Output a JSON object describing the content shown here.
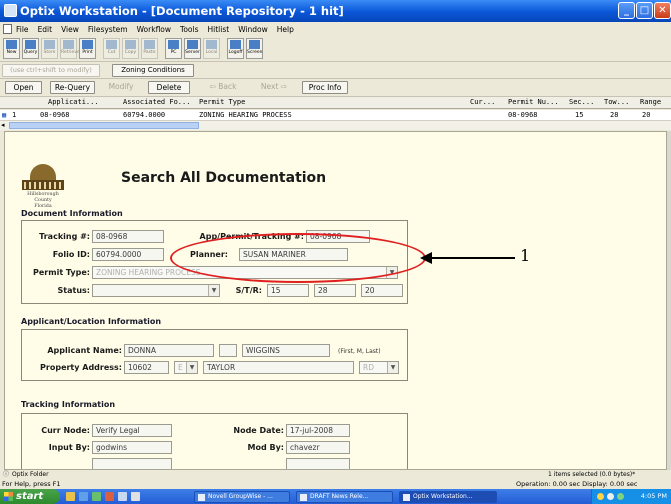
{
  "window": {
    "title": "Optix Workstation - [Document Repository - 1 hit]"
  },
  "menu": [
    "File",
    "Edit",
    "View",
    "Filesystem",
    "Workflow",
    "Tools",
    "Hitlist",
    "Window",
    "Help"
  ],
  "toolbar": [
    "New",
    "Query",
    "Store",
    "Retrieve",
    "Print",
    "Cut",
    "Copy",
    "Paste",
    "PC",
    "Server",
    "Local",
    "Logoff",
    "Screen"
  ],
  "actions": {
    "ctrl_shift_hint": "(use ctrl+shift to modify)",
    "zoning_conditions": "Zoning Conditions",
    "open": "Open",
    "requery": "Re-Query",
    "modify": "Modify",
    "delete": "Delete",
    "back": "Back",
    "next": "Next",
    "proc_info": "Proc Info"
  },
  "hitlist": {
    "columns": [
      "Applicati...",
      "Associated Fo...",
      "Permit Type",
      "Cur...",
      "Permit Nu...",
      "Sec...",
      "Tow...",
      "Range"
    ],
    "rows": [
      {
        "num": "1",
        "app": "08-0968",
        "folio": "60794.0000",
        "type": "ZONING HEARING PROCESS",
        "cur": "",
        "permit": "08-0968",
        "sec": "15",
        "tow": "28",
        "range": "20"
      }
    ]
  },
  "page": {
    "title": "Search All Documentation"
  },
  "logo": {
    "line1": "Hillsborough County",
    "line2": "Florida"
  },
  "doc_info": {
    "heading": "Document Information",
    "tracking_label": "Tracking #:",
    "tracking": "08-0968",
    "app_label": "App/Permit/Tracking #:",
    "app": "08-0968",
    "folio_label": "Folio ID:",
    "folio": "60794.0000",
    "planner_label": "Planner:",
    "planner": "SUSAN MARINER",
    "permit_type_label": "Permit Type:",
    "permit_type": "ZONING HEARING PROCESS",
    "status_label": "Status:",
    "status": "",
    "str_label": "S/T/R:",
    "s": "15",
    "t": "28",
    "r": "20"
  },
  "applicant": {
    "heading": "Applicant/Location Information",
    "name_label": "Applicant Name:",
    "first": "DONNA",
    "middle": "",
    "last": "WIGGINS",
    "name_hint": "(First, M, Last)",
    "address_label": "Property Address:",
    "number": "10602",
    "dir": "E",
    "street": "TAYLOR",
    "suffix": "RD"
  },
  "tracking": {
    "heading": "Tracking Information",
    "curr_node_label": "Curr Node:",
    "curr_node": "Verify Legal",
    "node_date_label": "Node Date:",
    "node_date": "17-jul-2008",
    "input_by_label": "Input By:",
    "input_by": "godwins",
    "mod_by_label": "Mod By:",
    "mod_by": "chavezr"
  },
  "annotation": {
    "callout": "1"
  },
  "status": {
    "folder": "Optix Folder",
    "selected": "1 items selected (0.0 bytes)*",
    "help": "For Help, press F1",
    "operation": "Operation:  0.00 sec   Display:  0.00 sec"
  },
  "taskbar": {
    "start": "start",
    "tasks": [
      "Novell GroupWise - ...",
      "DRAFT News Rele...",
      "Optix Workstation..."
    ],
    "clock": "4:05 PM"
  },
  "colors": {
    "title_bar": "#0a56d8",
    "annotation": "#e02020",
    "form_bg": "#fffde8"
  }
}
